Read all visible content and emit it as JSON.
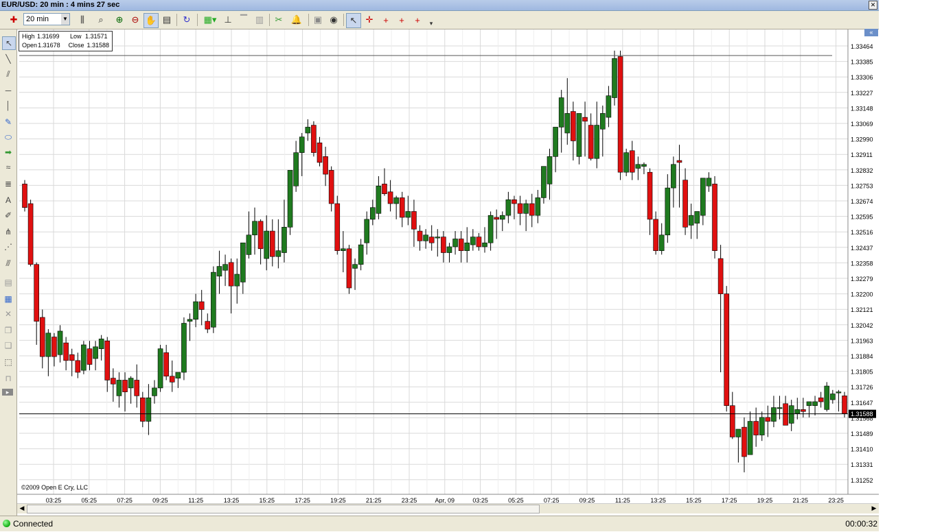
{
  "window": {
    "title": "EUR/USD: 20 min : 4 mins 27 sec",
    "close_glyph": "✕"
  },
  "toolbar": {
    "timeframe_value": "20 min",
    "icons": [
      "pin-icon",
      "bar-type-icon",
      "zoom-icon",
      "zoom-in-icon",
      "zoom-out-icon",
      "pan-icon",
      "properties-icon",
      "refresh-icon",
      "indicator-icon",
      "hierarchy-icon",
      "align-icon",
      "bars-icon",
      "scissors-icon",
      "alert-bell-icon",
      "disk-icon",
      "eye-icon",
      "pointer-icon",
      "crosshair-icon",
      "crosshair-red-icon",
      "crosshair-red2-icon",
      "crosshair-red3-icon",
      "dropdown-icon"
    ]
  },
  "left_tools": [
    "cursor-icon",
    "line-icon",
    "parallel-lines-icon",
    "horizontal-line-icon",
    "vertical-line-icon",
    "note-icon",
    "ellipse-icon",
    "arrow-icon",
    "wave-icon",
    "fib-icon",
    "text-icon",
    "pencil-icon",
    "pitchfork-icon",
    "fan-icon",
    "channel-icon",
    "lock-icon",
    "layer-icon",
    "delete-icon",
    "copy-icon",
    "paste-icon",
    "select-area-icon",
    "unlock-icon",
    "expand-icon"
  ],
  "ohlc_box": {
    "high_label": "High",
    "high_value": "1.31699",
    "low_label": "Low",
    "low_value": "1.31571",
    "open_label": "Open",
    "open_value": "1.31678",
    "close_label": "Close",
    "close_value": "1.31588"
  },
  "copyright": "©2009 Open E Cry, LLC",
  "status": {
    "connection": "Connected",
    "timer": "00:00:32"
  },
  "colors": {
    "bull": "#1f7a1f",
    "bear": "#e01010",
    "grid": "#d9d9d9",
    "price_tag_bg": "#000000"
  },
  "chart_data": {
    "type": "candlestick",
    "symbol": "EUR/USD",
    "interval": "20 min",
    "y_ticks": [
      "1.33464",
      "1.33385",
      "1.33306",
      "1.33227",
      "1.33148",
      "1.33069",
      "1.32990",
      "1.32911",
      "1.32832",
      "1.32753",
      "1.32674",
      "1.32595",
      "1.32516",
      "1.32437",
      "1.32358",
      "1.32279",
      "1.32200",
      "1.32121",
      "1.32042",
      "1.31963",
      "1.31884",
      "1.31805",
      "1.31726",
      "1.31647",
      "1.31568",
      "1.31489",
      "1.31410",
      "1.31331",
      "1.31252"
    ],
    "x_ticks": [
      "03:25",
      "05:25",
      "07:25",
      "09:25",
      "11:25",
      "13:25",
      "15:25",
      "17:25",
      "19:25",
      "21:25",
      "23:25",
      "Apr, 09",
      "03:25",
      "05:25",
      "07:25",
      "09:25",
      "11:25",
      "13:25",
      "15:25",
      "17:25",
      "19:25",
      "21:25",
      "23:25"
    ],
    "last_price": "1.31588",
    "resistance_line": 1.33415,
    "ylim": [
      1.312,
      1.3352
    ],
    "candles": [
      [
        1.3276,
        1.3278,
        1.3262,
        1.3264
      ],
      [
        1.3266,
        1.3268,
        1.3234,
        1.3235
      ],
      [
        1.3235,
        1.3236,
        1.3194,
        1.3206
      ],
      [
        1.3208,
        1.3212,
        1.3182,
        1.3188
      ],
      [
        1.3188,
        1.3202,
        1.3178,
        1.32
      ],
      [
        1.3198,
        1.32,
        1.3183,
        1.3188
      ],
      [
        1.3189,
        1.3204,
        1.3185,
        1.3201
      ],
      [
        1.3195,
        1.3198,
        1.3181,
        1.3186
      ],
      [
        1.3189,
        1.3192,
        1.3178,
        1.3186
      ],
      [
        1.3186,
        1.319,
        1.3177,
        1.318
      ],
      [
        1.3181,
        1.3196,
        1.3179,
        1.3194
      ],
      [
        1.3192,
        1.3196,
        1.3181,
        1.3184
      ],
      [
        1.3187,
        1.3196,
        1.3181,
        1.3193
      ],
      [
        1.3192,
        1.3199,
        1.3186,
        1.3197
      ],
      [
        1.3196,
        1.3198,
        1.317,
        1.3176
      ],
      [
        1.3177,
        1.3182,
        1.3165,
        1.3174
      ],
      [
        1.3168,
        1.318,
        1.3162,
        1.3176
      ],
      [
        1.3176,
        1.318,
        1.316,
        1.317
      ],
      [
        1.3172,
        1.3178,
        1.3164,
        1.3177
      ],
      [
        1.3176,
        1.3184,
        1.3162,
        1.3168
      ],
      [
        1.3167,
        1.317,
        1.3152,
        1.3155
      ],
      [
        1.3155,
        1.3174,
        1.3148,
        1.3167
      ],
      [
        1.3168,
        1.3176,
        1.3164,
        1.3172
      ],
      [
        1.3172,
        1.3194,
        1.317,
        1.3192
      ],
      [
        1.319,
        1.3194,
        1.3176,
        1.3178
      ],
      [
        1.3178,
        1.3186,
        1.317,
        1.3175
      ],
      [
        1.3177,
        1.318,
        1.3172,
        1.318
      ],
      [
        1.318,
        1.3208,
        1.3176,
        1.3205
      ],
      [
        1.3206,
        1.321,
        1.3196,
        1.3207
      ],
      [
        1.3207,
        1.322,
        1.3203,
        1.3216
      ],
      [
        1.3216,
        1.3222,
        1.3204,
        1.3212
      ],
      [
        1.3206,
        1.321,
        1.32,
        1.3202
      ],
      [
        1.3203,
        1.3234,
        1.32,
        1.3231
      ],
      [
        1.3229,
        1.3242,
        1.322,
        1.3234
      ],
      [
        1.3232,
        1.324,
        1.3224,
        1.3235
      ],
      [
        1.3236,
        1.3238,
        1.321,
        1.3224
      ],
      [
        1.3224,
        1.3238,
        1.3215,
        1.323
      ],
      [
        1.3226,
        1.324,
        1.322,
        1.3246
      ],
      [
        1.324,
        1.3262,
        1.3238,
        1.325
      ],
      [
        1.325,
        1.3264,
        1.324,
        1.3257
      ],
      [
        1.3257,
        1.3258,
        1.3235,
        1.3243
      ],
      [
        1.3238,
        1.326,
        1.3232,
        1.3252
      ],
      [
        1.3252,
        1.3258,
        1.3234,
        1.3239
      ],
      [
        1.3239,
        1.3258,
        1.3233,
        1.3242
      ],
      [
        1.3241,
        1.3268,
        1.3236,
        1.3254
      ],
      [
        1.3254,
        1.3278,
        1.325,
        1.3283
      ],
      [
        1.3275,
        1.3298,
        1.3272,
        1.3292
      ],
      [
        1.3292,
        1.3302,
        1.328,
        1.33
      ],
      [
        1.3302,
        1.3309,
        1.3298,
        1.3305
      ],
      [
        1.3306,
        1.3308,
        1.329,
        1.3292
      ],
      [
        1.3297,
        1.33,
        1.3285,
        1.3287
      ],
      [
        1.329,
        1.3295,
        1.3275,
        1.3281
      ],
      [
        1.3283,
        1.3285,
        1.3262,
        1.3266
      ],
      [
        1.3266,
        1.327,
        1.324,
        1.3242
      ],
      [
        1.3242,
        1.3252,
        1.3231,
        1.3243
      ],
      [
        1.3243,
        1.3245,
        1.322,
        1.3223
      ],
      [
        1.3233,
        1.3238,
        1.3222,
        1.3235
      ],
      [
        1.3235,
        1.3248,
        1.3232,
        1.3245
      ],
      [
        1.3246,
        1.3262,
        1.324,
        1.3258
      ],
      [
        1.3258,
        1.3268,
        1.3255,
        1.3264
      ],
      [
        1.3261,
        1.328,
        1.3258,
        1.3275
      ],
      [
        1.3276,
        1.3284,
        1.327,
        1.3271
      ],
      [
        1.3272,
        1.3278,
        1.3262,
        1.3266
      ],
      [
        1.3266,
        1.327,
        1.3258,
        1.3269
      ],
      [
        1.3269,
        1.3272,
        1.3254,
        1.3259
      ],
      [
        1.3259,
        1.327,
        1.3255,
        1.3262
      ],
      [
        1.3262,
        1.3268,
        1.3244,
        1.3253
      ],
      [
        1.3252,
        1.3255,
        1.3242,
        1.3247
      ],
      [
        1.3247,
        1.3253,
        1.3243,
        1.325
      ],
      [
        1.3249,
        1.3255,
        1.3242,
        1.3246
      ],
      [
        1.3249,
        1.3253,
        1.3239,
        1.3249
      ],
      [
        1.3249,
        1.3252,
        1.3236,
        1.3241
      ],
      [
        1.3241,
        1.3246,
        1.3236,
        1.3244
      ],
      [
        1.3244,
        1.3252,
        1.324,
        1.3248
      ],
      [
        1.3248,
        1.3252,
        1.3236,
        1.3242
      ],
      [
        1.3242,
        1.3254,
        1.3236,
        1.3246
      ],
      [
        1.3245,
        1.3253,
        1.3242,
        1.3249
      ],
      [
        1.3249,
        1.3251,
        1.3242,
        1.3244
      ],
      [
        1.3244,
        1.3254,
        1.3241,
        1.3246
      ],
      [
        1.3246,
        1.3262,
        1.3242,
        1.326
      ],
      [
        1.3259,
        1.3263,
        1.3248,
        1.3258
      ],
      [
        1.3258,
        1.3262,
        1.3252,
        1.326
      ],
      [
        1.326,
        1.3272,
        1.3256,
        1.3268
      ],
      [
        1.3268,
        1.327,
        1.3258,
        1.3266
      ],
      [
        1.3266,
        1.327,
        1.3255,
        1.3261
      ],
      [
        1.3261,
        1.3268,
        1.3252,
        1.3266
      ],
      [
        1.3266,
        1.3271,
        1.3254,
        1.326
      ],
      [
        1.326,
        1.3273,
        1.3256,
        1.3269
      ],
      [
        1.3269,
        1.3282,
        1.3266,
        1.3285
      ],
      [
        1.3276,
        1.3294,
        1.3268,
        1.329
      ],
      [
        1.329,
        1.3298,
        1.3282,
        1.3305
      ],
      [
        1.3305,
        1.3324,
        1.3292,
        1.332
      ],
      [
        1.3302,
        1.333,
        1.3296,
        1.3312
      ],
      [
        1.3313,
        1.3318,
        1.3288,
        1.3298
      ],
      [
        1.329,
        1.33,
        1.3286,
        1.3312
      ],
      [
        1.331,
        1.3318,
        1.329,
        1.3308
      ],
      [
        1.3306,
        1.3312,
        1.3288,
        1.3289
      ],
      [
        1.3289,
        1.3318,
        1.3284,
        1.3306
      ],
      [
        1.3304,
        1.3316,
        1.329,
        1.3312
      ],
      [
        1.331,
        1.3326,
        1.3305,
        1.3321
      ],
      [
        1.332,
        1.3344,
        1.3316,
        1.334
      ],
      [
        1.3341,
        1.3344,
        1.3278,
        1.3282
      ],
      [
        1.3282,
        1.3294,
        1.328,
        1.3292
      ],
      [
        1.3293,
        1.3298,
        1.3278,
        1.3282
      ],
      [
        1.3284,
        1.329,
        1.3278,
        1.3286
      ],
      [
        1.3285,
        1.3287,
        1.3281,
        1.3286
      ],
      [
        1.3282,
        1.3284,
        1.325,
        1.3258
      ],
      [
        1.3258,
        1.3262,
        1.324,
        1.3242
      ],
      [
        1.3242,
        1.3256,
        1.324,
        1.325
      ],
      [
        1.325,
        1.3281,
        1.3246,
        1.3274
      ],
      [
        1.3274,
        1.329,
        1.3264,
        1.3286
      ],
      [
        1.3288,
        1.3296,
        1.3264,
        1.3287
      ],
      [
        1.3278,
        1.3284,
        1.325,
        1.3254
      ],
      [
        1.3255,
        1.3266,
        1.3248,
        1.326
      ],
      [
        1.3256,
        1.3262,
        1.3248,
        1.3262
      ],
      [
        1.326,
        1.3275,
        1.3255,
        1.3279
      ],
      [
        1.3275,
        1.3282,
        1.3272,
        1.3279
      ],
      [
        1.3276,
        1.328,
        1.3238,
        1.3242
      ],
      [
        1.3238,
        1.3245,
        1.318,
        1.322
      ],
      [
        1.322,
        1.3224,
        1.316,
        1.3163
      ],
      [
        1.3163,
        1.317,
        1.3146,
        1.3147
      ],
      [
        1.3147,
        1.315,
        1.3134,
        1.3151
      ],
      [
        1.3152,
        1.3157,
        1.3129,
        1.3137
      ],
      [
        1.3138,
        1.316,
        1.3138,
        1.3155
      ],
      [
        1.3155,
        1.3162,
        1.3142,
        1.3148
      ],
      [
        1.3148,
        1.316,
        1.3145,
        1.3157
      ],
      [
        1.3157,
        1.3163,
        1.3147,
        1.3155
      ],
      [
        1.3155,
        1.3168,
        1.3152,
        1.3162
      ],
      [
        1.3162,
        1.3168,
        1.3156,
        1.3162
      ],
      [
        1.3164,
        1.3168,
        1.3156,
        1.3153
      ],
      [
        1.3154,
        1.3166,
        1.315,
        1.3163
      ],
      [
        1.3159,
        1.3167,
        1.3156,
        1.3161
      ],
      [
        1.3161,
        1.3167,
        1.3157,
        1.316
      ],
      [
        1.3163,
        1.3165,
        1.3157,
        1.3165
      ],
      [
        1.3163,
        1.3168,
        1.3158,
        1.3165
      ],
      [
        1.3167,
        1.317,
        1.3162,
        1.3165
      ],
      [
        1.3161,
        1.3175,
        1.316,
        1.3173
      ],
      [
        1.3166,
        1.3171,
        1.3164,
        1.3169
      ],
      [
        1.317,
        1.3171,
        1.316,
        1.317
      ],
      [
        1.3168,
        1.317,
        1.3157,
        1.3159
      ]
    ]
  }
}
